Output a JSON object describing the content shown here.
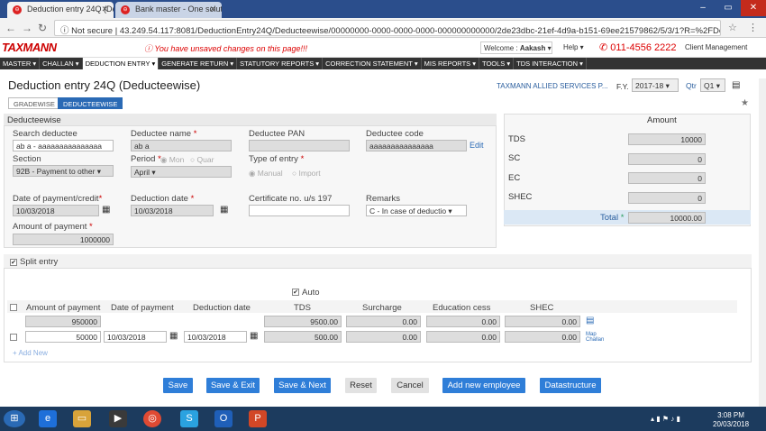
{
  "browser": {
    "tabs": [
      {
        "label": "Deduction entry 24Q (De"
      },
      {
        "label": "Bank master - One soluti"
      }
    ],
    "url": "43.249.54.117:8081/DeductionEntry24Q/Deducteewise/00000000-0000-0000-0000-000000000000/2de23dbc-21ef-4d9a-b151-69ee21579862/5/3/1?R=%2FDeductionEntry24Q...",
    "secure_label": "Not secure"
  },
  "app": {
    "logo": "TAXMANN",
    "unsaved": "You have unsaved changes on this page!!!",
    "welcome_prefix": "Welcome : ",
    "welcome_user": "Aakash",
    "help": "Help ▾",
    "phone": "011-4556 2222",
    "client_mgmt": "Client Management"
  },
  "menu": [
    "MASTER ▾",
    "CHALLAN ▾",
    "DEDUCTION ENTRY ▾",
    "GENERATE RETURN ▾",
    "STATUTORY REPORTS ▾",
    "CORRECTION STATEMENT ▾",
    "MIS REPORTS ▾",
    "TOOLS ▾",
    "TDS INTERACTION ▾"
  ],
  "page": {
    "title": "Deduction entry 24Q (Deducteewise)",
    "company": "TAXMANN ALLIED SERVICES P...",
    "fy_label": "F.Y.",
    "fy_value": "2017-18",
    "qtr_label": "Qtr",
    "qtr_value": "Q1",
    "tab_gradewise": "GRADEWISE",
    "tab_deducteewise": "DEDUCTEEWISE"
  },
  "deductee": {
    "header": "Deducteewise",
    "search_label": "Search deductee",
    "search_value": "ab  a - aaaaaaaaaaaaaaa",
    "name_label": "Deductee name",
    "name_value": "ab a",
    "pan_label": "Deductee PAN",
    "pan_value": "",
    "code_label": "Deductee code",
    "code_value": "aaaaaaaaaaaaaaa",
    "edit": "Edit",
    "section_label": "Section",
    "section_value": "92B - Payment to other",
    "period_label": "Period",
    "period_mon": "Mon",
    "period_quar": "Quar",
    "period_value": "April",
    "type_label": "Type of entry",
    "type_manual": "Manual",
    "type_import": "Import",
    "dop_label": "Date of payment/credit",
    "dop_value": "10/03/2018",
    "ded_date_label": "Deduction date",
    "ded_date_value": "10/03/2018",
    "cert_label": "Certificate no. u/s 197",
    "cert_value": "",
    "remarks_label": "Remarks",
    "remarks_value": "C - In case of deductio",
    "amount_label": "Amount of payment",
    "amount_value": "1000000"
  },
  "amounts": {
    "header": "Amount",
    "tds_label": "TDS",
    "tds": "10000",
    "sc_label": "SC",
    "sc": "0",
    "ec_label": "EC",
    "ec": "0",
    "shec_label": "SHEC",
    "shec": "0",
    "total_label": "Total",
    "total": "10000.00"
  },
  "split": {
    "label": "Split entry",
    "auto": "Auto",
    "cols": [
      "Amount of payment",
      "Date of payment",
      "Deduction date",
      "TDS",
      "Surcharge",
      "Education cess",
      "SHEC"
    ],
    "row1": {
      "amount": "950000",
      "tds": "9500.00",
      "surcharge": "0.00",
      "ecess": "0.00",
      "shec": "0.00"
    },
    "row2": {
      "amount": "50000",
      "dop": "10/03/2018",
      "ded": "10/03/2018",
      "tds": "500.00",
      "surcharge": "0.00",
      "ecess": "0.00",
      "shec": "0.00",
      "map": "Map Challan"
    },
    "add_new": "+ Add New"
  },
  "buttons": {
    "save": "Save",
    "save_exit": "Save & Exit",
    "save_next": "Save & Next",
    "reset": "Reset",
    "cancel": "Cancel",
    "add_emp": "Add new employee",
    "datastructure": "Datastructure"
  },
  "taskbar": {
    "time": "3:08 PM",
    "date": "20/03/2018"
  }
}
